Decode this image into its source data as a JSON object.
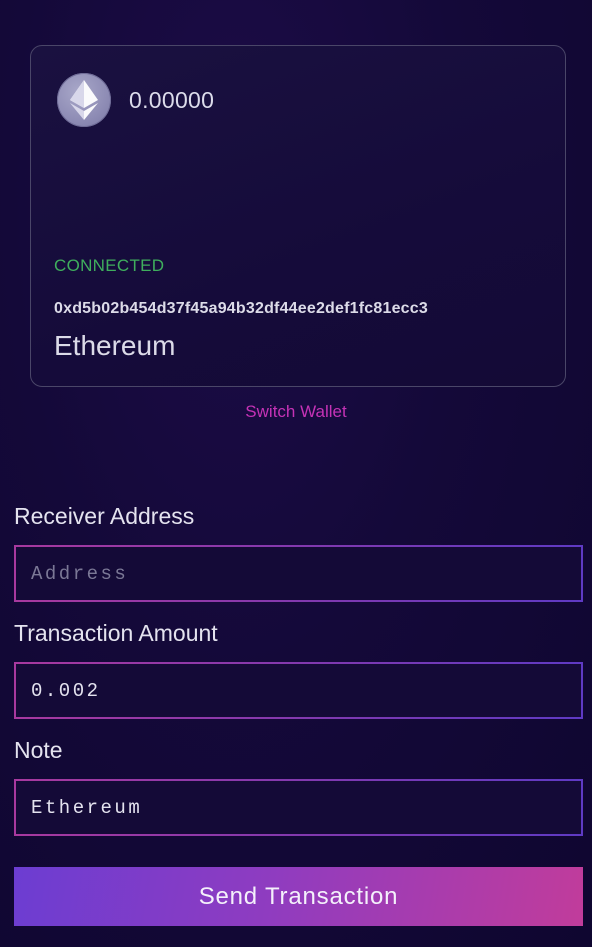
{
  "wallet": {
    "icon": "ethereum-logo-icon",
    "balance": "0.00000",
    "status": "CONNECTED",
    "status_color": "#3fae5d",
    "address": "0xd5b02b454d37f45a94b32df44ee2def1fc81ecc3",
    "network": "Ethereum"
  },
  "switch_wallet_label": "Switch Wallet",
  "form": {
    "receiver": {
      "label": "Receiver Address",
      "value": "",
      "placeholder": "Address"
    },
    "amount": {
      "label": "Transaction Amount",
      "value": "0.002",
      "placeholder": ""
    },
    "note": {
      "label": "Note",
      "value": "Ethereum",
      "placeholder": ""
    },
    "submit_label": "Send Transaction"
  },
  "colors": {
    "background": "#110734",
    "accent": "#c532b6",
    "button_gradient_start": "#6c3dd2",
    "button_gradient_end": "#c13c9b"
  }
}
